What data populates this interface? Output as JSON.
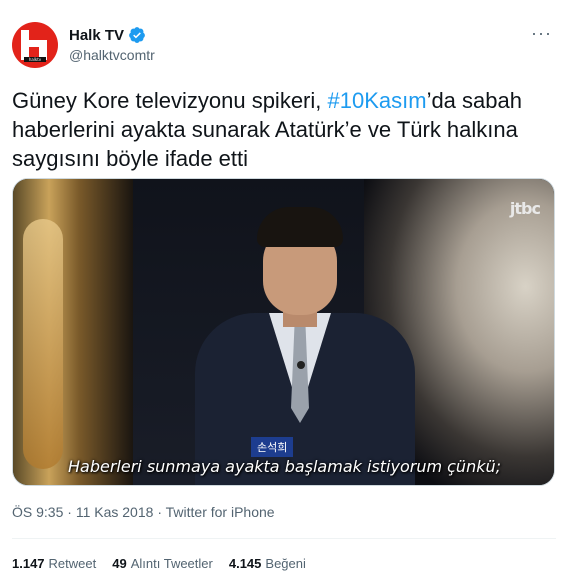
{
  "tweet": {
    "author": {
      "display_name": "Halk TV",
      "handle": "@halktvcomtr",
      "avatar_tag": "halktv"
    },
    "more_label": "···",
    "text_parts": {
      "before": "Güney Kore televizyonu spikeri, ",
      "hashtag": "#10Kasım",
      "after": "’da sabah haberlerini ayakta sunarak Atatürk’e ve Türk halkına saygısını böyle ifade etti"
    },
    "media": {
      "channel_logo": "jtbc",
      "name_caption": "손석희",
      "subtitle": "Haberleri sunmaya ayakta başlamak istiyorum çünkü;"
    },
    "meta": {
      "time": "ÖS 9:35",
      "date": "11 Kas 2018",
      "source": "Twitter for iPhone",
      "separator": "·"
    },
    "stats": {
      "retweets_count": "1.147",
      "retweets_label": "Retweet",
      "quotes_count": "49",
      "quotes_label": "Alıntı Tweetler",
      "likes_count": "4.145",
      "likes_label": "Beğeni"
    }
  },
  "colors": {
    "accent": "#1d9bf0",
    "brand_red": "#e2231a",
    "text_primary": "#0f1419",
    "text_secondary": "#536471"
  },
  "icons": {
    "verified": "verified-badge-icon",
    "more": "more-options-icon"
  }
}
